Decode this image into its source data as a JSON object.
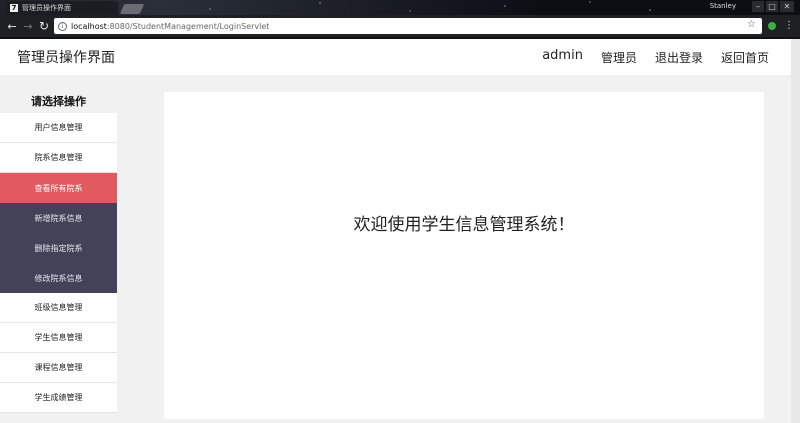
{
  "browser": {
    "tab_title": "管理员操作界面",
    "tab_favicon": "7",
    "user": "Stanley",
    "url_host": "localhost",
    "url_path": ":8080/StudentManagement/LoginServlet"
  },
  "header": {
    "title": "管理员操作界面",
    "nav": [
      "admin",
      "管理员",
      "退出登录",
      "返回首页"
    ]
  },
  "sidebar": {
    "heading": "请选择操作",
    "items": [
      {
        "label": "用户信息管理",
        "state": "normal"
      },
      {
        "label": "院系信息管理",
        "state": "normal"
      },
      {
        "label": "查看所有院系",
        "state": "active"
      },
      {
        "label": "新增院系信息",
        "state": "sub"
      },
      {
        "label": "删除指定院系",
        "state": "sub"
      },
      {
        "label": "修改院系信息",
        "state": "sub"
      },
      {
        "label": "班级信息管理",
        "state": "normal"
      },
      {
        "label": "学生信息管理",
        "state": "normal"
      },
      {
        "label": "课程信息管理",
        "state": "normal"
      },
      {
        "label": "学生成绩管理",
        "state": "normal"
      }
    ]
  },
  "main": {
    "welcome": "欢迎使用学生信息管理系统！"
  },
  "colors": {
    "active": "#e05a5f",
    "submenu": "#434258"
  },
  "icons": {
    "back": "back-arrow-icon",
    "forward": "forward-arrow-icon",
    "reload": "reload-icon",
    "info": "info-icon",
    "bookmark": "star-icon",
    "menu": "kebab-menu-icon"
  }
}
